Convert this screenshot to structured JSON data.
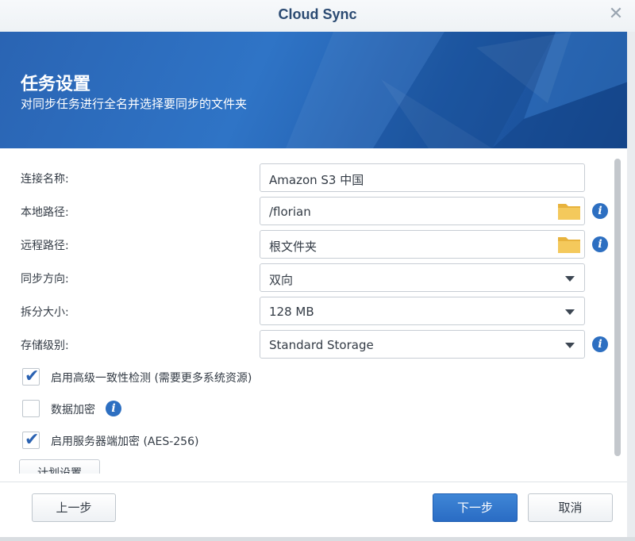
{
  "window": {
    "title": "Cloud Sync"
  },
  "banner": {
    "title": "任务设置",
    "subtitle": "对同步任务进行全名并选择要同步的文件夹"
  },
  "form": {
    "connection_name": {
      "label": "连接名称:",
      "value": "Amazon S3 中国"
    },
    "local_path": {
      "label": "本地路径:",
      "value": "/florian"
    },
    "remote_path": {
      "label": "远程路径:",
      "value": "根文件夹"
    },
    "sync_direction": {
      "label": "同步方向:",
      "value": "双向"
    },
    "part_size": {
      "label": "拆分大小:",
      "value": "128 MB"
    },
    "storage_class": {
      "label": "存储级别:",
      "value": "Standard Storage"
    }
  },
  "options": {
    "consistency_check": {
      "label": "启用高级一致性检测 (需要更多系统资源)",
      "checked": true
    },
    "data_encryption": {
      "label": "数据加密",
      "checked": false
    },
    "server_side_encryption": {
      "label": "启用服务器端加密 (AES-256)",
      "checked": true
    }
  },
  "partial_button_label": "计划设置",
  "footer": {
    "prev_label": "上一步",
    "next_label": "下一步",
    "cancel_label": "取消"
  },
  "icons": {
    "close": "close-icon",
    "folder": "folder-icon",
    "info": "info-icon",
    "dropdown": "chevron-down-icon",
    "check": "checkmark-icon"
  },
  "colors": {
    "accent": "#2a6cc4",
    "banner": "#2a64b3",
    "title": "#2b4a72",
    "folder": "#f0c455"
  }
}
